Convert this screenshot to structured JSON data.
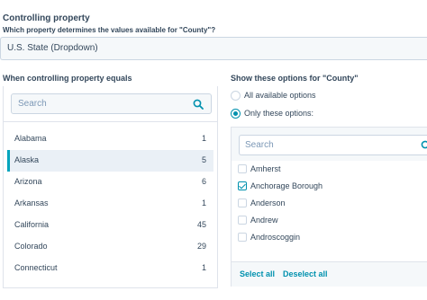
{
  "controlling": {
    "title": "Controlling property",
    "help": "Which property determines the values available for \"County\"?",
    "selected_value": "U.S. State (Dropdown)"
  },
  "left": {
    "label": "When controlling property equals",
    "search_placeholder": "Search",
    "states": [
      {
        "name": "Alabama",
        "count": "1"
      },
      {
        "name": "Alaska",
        "count": "5"
      },
      {
        "name": "Arizona",
        "count": "6"
      },
      {
        "name": "Arkansas",
        "count": "1"
      },
      {
        "name": "California",
        "count": "45"
      },
      {
        "name": "Colorado",
        "count": "29"
      },
      {
        "name": "Connecticut",
        "count": "1"
      }
    ]
  },
  "right": {
    "label": "Show these options for \"County\"",
    "radio_all": "All available options",
    "radio_only": "Only these options:",
    "search_placeholder": "Search",
    "options": [
      {
        "label": "Amherst",
        "checked": false
      },
      {
        "label": "Anchorage Borough",
        "checked": true
      },
      {
        "label": "Anderson",
        "checked": false
      },
      {
        "label": "Andrew",
        "checked": false
      },
      {
        "label": "Androscoggin",
        "checked": false
      }
    ],
    "select_all": "Select all",
    "deselect_all": "Deselect all"
  },
  "colors": {
    "accent": "#0091ae",
    "text": "#33475b",
    "border": "#cbd6e2",
    "panel_bg": "#f5f8fa"
  }
}
